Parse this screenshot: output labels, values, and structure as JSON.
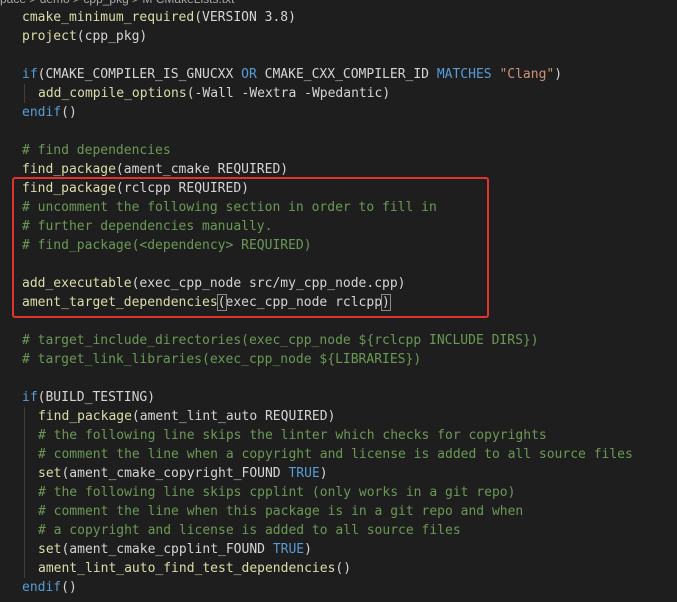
{
  "breadcrumb": "pace > demo > cpp_pkg > M CMakeLists.txt",
  "lines": [
    {
      "indent": false,
      "tokens": [
        {
          "c": "fn",
          "t": "cmake_minimum_required"
        },
        {
          "c": "txt",
          "t": "(VERSION 3.8)"
        }
      ]
    },
    {
      "indent": false,
      "tokens": [
        {
          "c": "fn",
          "t": "project"
        },
        {
          "c": "txt",
          "t": "(cpp_pkg)"
        }
      ]
    },
    {
      "indent": false,
      "tokens": []
    },
    {
      "indent": false,
      "tokens": [
        {
          "c": "kw",
          "t": "if"
        },
        {
          "c": "txt",
          "t": "(CMAKE_COMPILER_IS_GNUCXX "
        },
        {
          "c": "kw",
          "t": "OR"
        },
        {
          "c": "txt",
          "t": " CMAKE_CXX_COMPILER_ID "
        },
        {
          "c": "kw",
          "t": "MATCHES"
        },
        {
          "c": "txt",
          "t": " "
        },
        {
          "c": "str",
          "t": "\"Clang\""
        },
        {
          "c": "txt",
          "t": ")"
        }
      ]
    },
    {
      "indent": true,
      "tokens": [
        {
          "c": "fn",
          "t": "add_compile_options"
        },
        {
          "c": "txt",
          "t": "(-Wall -Wextra -Wpedantic)"
        }
      ]
    },
    {
      "indent": false,
      "tokens": [
        {
          "c": "kw",
          "t": "endif"
        },
        {
          "c": "txt",
          "t": "()"
        }
      ]
    },
    {
      "indent": false,
      "tokens": []
    },
    {
      "indent": false,
      "tokens": [
        {
          "c": "cm",
          "t": "# find dependencies"
        }
      ]
    },
    {
      "indent": false,
      "tokens": [
        {
          "c": "fn",
          "t": "find_package"
        },
        {
          "c": "txt",
          "t": "(ament_cmake REQUIRED)"
        }
      ]
    },
    {
      "indent": false,
      "tokens": [
        {
          "c": "fn",
          "t": "find_package"
        },
        {
          "c": "txt",
          "t": "(rclcpp REQUIRED)"
        }
      ]
    },
    {
      "indent": false,
      "tokens": [
        {
          "c": "cm",
          "t": "# uncomment the following section in order to fill in"
        }
      ]
    },
    {
      "indent": false,
      "tokens": [
        {
          "c": "cm",
          "t": "# further dependencies manually."
        }
      ]
    },
    {
      "indent": false,
      "tokens": [
        {
          "c": "cm",
          "t": "# find_package(<dependency> REQUIRED)"
        }
      ]
    },
    {
      "indent": false,
      "tokens": []
    },
    {
      "indent": false,
      "tokens": [
        {
          "c": "fn",
          "t": "add_executable"
        },
        {
          "c": "txt",
          "t": "(exec_cpp_node src/my_cpp_node.cpp)"
        }
      ]
    },
    {
      "indent": false,
      "tokens": [
        {
          "c": "fn",
          "t": "ament_target_dependencies"
        },
        {
          "c": "txt box",
          "t": "("
        },
        {
          "c": "txt",
          "t": "exec_cpp_node rclcpp"
        },
        {
          "c": "txt box",
          "t": ")"
        }
      ]
    },
    {
      "indent": false,
      "tokens": []
    },
    {
      "indent": false,
      "tokens": [
        {
          "c": "cm",
          "t": "# target_include_directories(exec_cpp_node ${rclcpp INCLUDE DIRS})"
        }
      ]
    },
    {
      "indent": false,
      "tokens": [
        {
          "c": "cm",
          "t": "# target_link_libraries(exec_cpp_node ${LIBRARIES})"
        }
      ]
    },
    {
      "indent": false,
      "tokens": []
    },
    {
      "indent": false,
      "tokens": [
        {
          "c": "kw",
          "t": "if"
        },
        {
          "c": "txt",
          "t": "(BUILD_TESTING)"
        }
      ]
    },
    {
      "indent": true,
      "tokens": [
        {
          "c": "fn",
          "t": "find_package"
        },
        {
          "c": "txt",
          "t": "(ament_lint_auto REQUIRED)"
        }
      ]
    },
    {
      "indent": true,
      "tokens": [
        {
          "c": "cm",
          "t": "# the following line skips the linter which checks for copyrights"
        }
      ]
    },
    {
      "indent": true,
      "tokens": [
        {
          "c": "cm",
          "t": "# comment the line when a copyright and license is added to all source files"
        }
      ]
    },
    {
      "indent": true,
      "tokens": [
        {
          "c": "fn",
          "t": "set"
        },
        {
          "c": "txt",
          "t": "(ament_cmake_copyright_FOUND "
        },
        {
          "c": "kw",
          "t": "TRUE"
        },
        {
          "c": "txt",
          "t": ")"
        }
      ]
    },
    {
      "indent": true,
      "tokens": [
        {
          "c": "cm",
          "t": "# the following line skips cpplint (only works in a git repo)"
        }
      ]
    },
    {
      "indent": true,
      "tokens": [
        {
          "c": "cm",
          "t": "# comment the line when this package is in a git repo and when"
        }
      ]
    },
    {
      "indent": true,
      "tokens": [
        {
          "c": "cm",
          "t": "# a copyright and license is added to all source files"
        }
      ]
    },
    {
      "indent": true,
      "tokens": [
        {
          "c": "fn",
          "t": "set"
        },
        {
          "c": "txt",
          "t": "(ament_cmake_cpplint_FOUND "
        },
        {
          "c": "kw",
          "t": "TRUE"
        },
        {
          "c": "txt",
          "t": ")"
        }
      ]
    },
    {
      "indent": true,
      "tokens": [
        {
          "c": "fn",
          "t": "ament_lint_auto_find_test_dependencies"
        },
        {
          "c": "txt",
          "t": "()"
        }
      ]
    },
    {
      "indent": false,
      "tokens": [
        {
          "c": "kw",
          "t": "endif"
        },
        {
          "c": "txt",
          "t": "()"
        }
      ]
    }
  ],
  "colors": {
    "background": "#1e1e1e",
    "keyword": "#569cd6",
    "function": "#dcdcaa",
    "string": "#ce9178",
    "comment": "#6a9955",
    "text": "#d4d4d4",
    "highlight_box": "#e0332b"
  }
}
